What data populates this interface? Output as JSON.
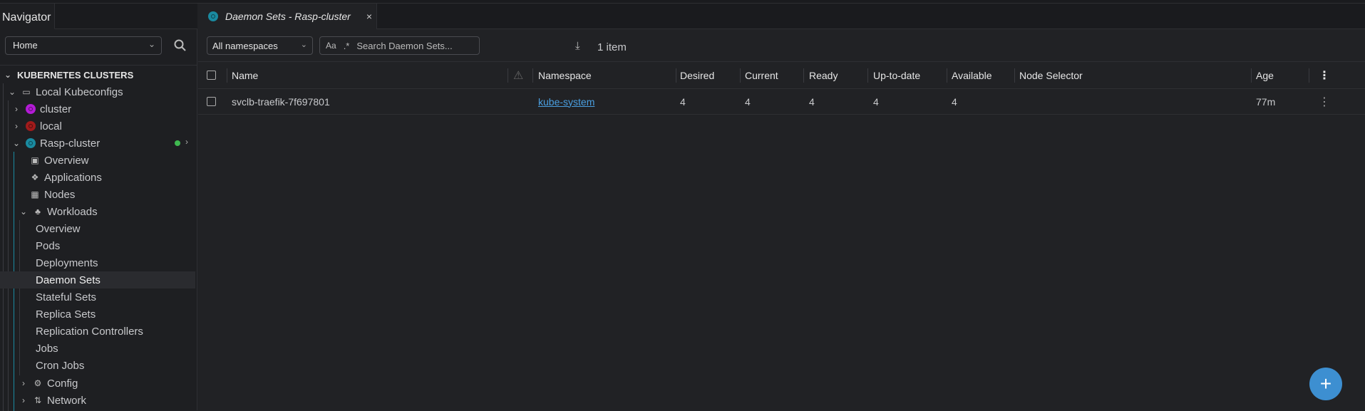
{
  "sidebar": {
    "tab": "Navigator",
    "hotbar": "Home",
    "section": "KUBERNETES CLUSTERS",
    "group": "Local Kubeconfigs",
    "clusters": [
      {
        "label": "cluster",
        "color": "#b31bd6"
      },
      {
        "label": "local",
        "color": "#a01b1b"
      },
      {
        "label": "Rasp-cluster",
        "color": "#1a8aa0"
      }
    ],
    "status_color": "#3fb950",
    "cluster_items": [
      "Overview",
      "Applications",
      "Nodes",
      "Workloads"
    ],
    "workloads": [
      "Overview",
      "Pods",
      "Deployments",
      "Daemon Sets",
      "Stateful Sets",
      "Replica Sets",
      "Replication Controllers",
      "Jobs",
      "Cron Jobs"
    ],
    "more": [
      "Config",
      "Network"
    ]
  },
  "tab": {
    "title": "Daemon Sets - Rasp-cluster",
    "close": "×"
  },
  "toolbar": {
    "namespace": "All namespaces",
    "case_toggle": "Aa",
    "regex_toggle": ".*",
    "search_placeholder": "Search Daemon Sets...",
    "count": "1 item"
  },
  "table": {
    "headers": [
      "Name",
      "Namespace",
      "Desired",
      "Current",
      "Ready",
      "Up-to-date",
      "Available",
      "Node Selector",
      "Age"
    ],
    "rows": [
      {
        "name": "svclb-traefik-7f697801",
        "namespace": "kube-system",
        "desired": "4",
        "current": "4",
        "ready": "4",
        "uptodate": "4",
        "available": "4",
        "nodeselector": "",
        "age": "77m"
      }
    ]
  },
  "fab": "+"
}
